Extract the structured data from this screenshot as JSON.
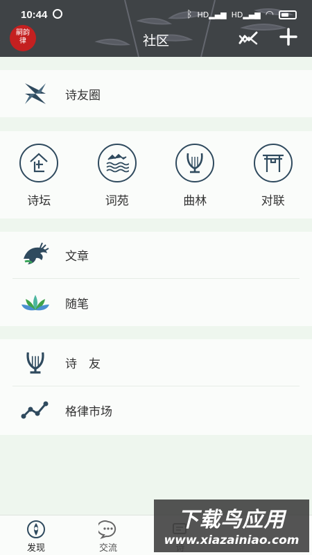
{
  "status_bar": {
    "time": "10:44",
    "signal_1": "HD",
    "signal_2": "HD"
  },
  "header": {
    "logo_text": "嗣韵律",
    "title": "社区"
  },
  "sections": {
    "friends_circle": {
      "label": "诗友圈"
    },
    "categories": [
      {
        "label": "诗坛",
        "icon": "poetry-hall-icon"
      },
      {
        "label": "词苑",
        "icon": "mountain-waves-icon"
      },
      {
        "label": "曲林",
        "icon": "lyre-icon"
      },
      {
        "label": "对联",
        "icon": "archway-icon"
      }
    ],
    "writing": [
      {
        "label": "文章",
        "icon": "dragon-icon"
      },
      {
        "label": "随笔",
        "icon": "lotus-icon"
      }
    ],
    "market": [
      {
        "label": "诗　友",
        "icon": "lyre-icon"
      },
      {
        "label": "格律市场",
        "icon": "trend-line-icon"
      }
    ]
  },
  "tabbar": [
    {
      "label": "发现",
      "icon": "discover-icon",
      "active": true
    },
    {
      "label": "交流",
      "icon": "chat-bubble-icon"
    },
    {
      "label": "诗",
      "icon": "poem-icon"
    }
  ],
  "watermark": {
    "line1": "下载鸟应用",
    "line2": "www.xiazainiao.com"
  },
  "colors": {
    "header_bg": "#3f4346",
    "page_bg": "#eef6ee",
    "icon_navy": "#2f4a5e",
    "logo_red": "#c42020"
  }
}
